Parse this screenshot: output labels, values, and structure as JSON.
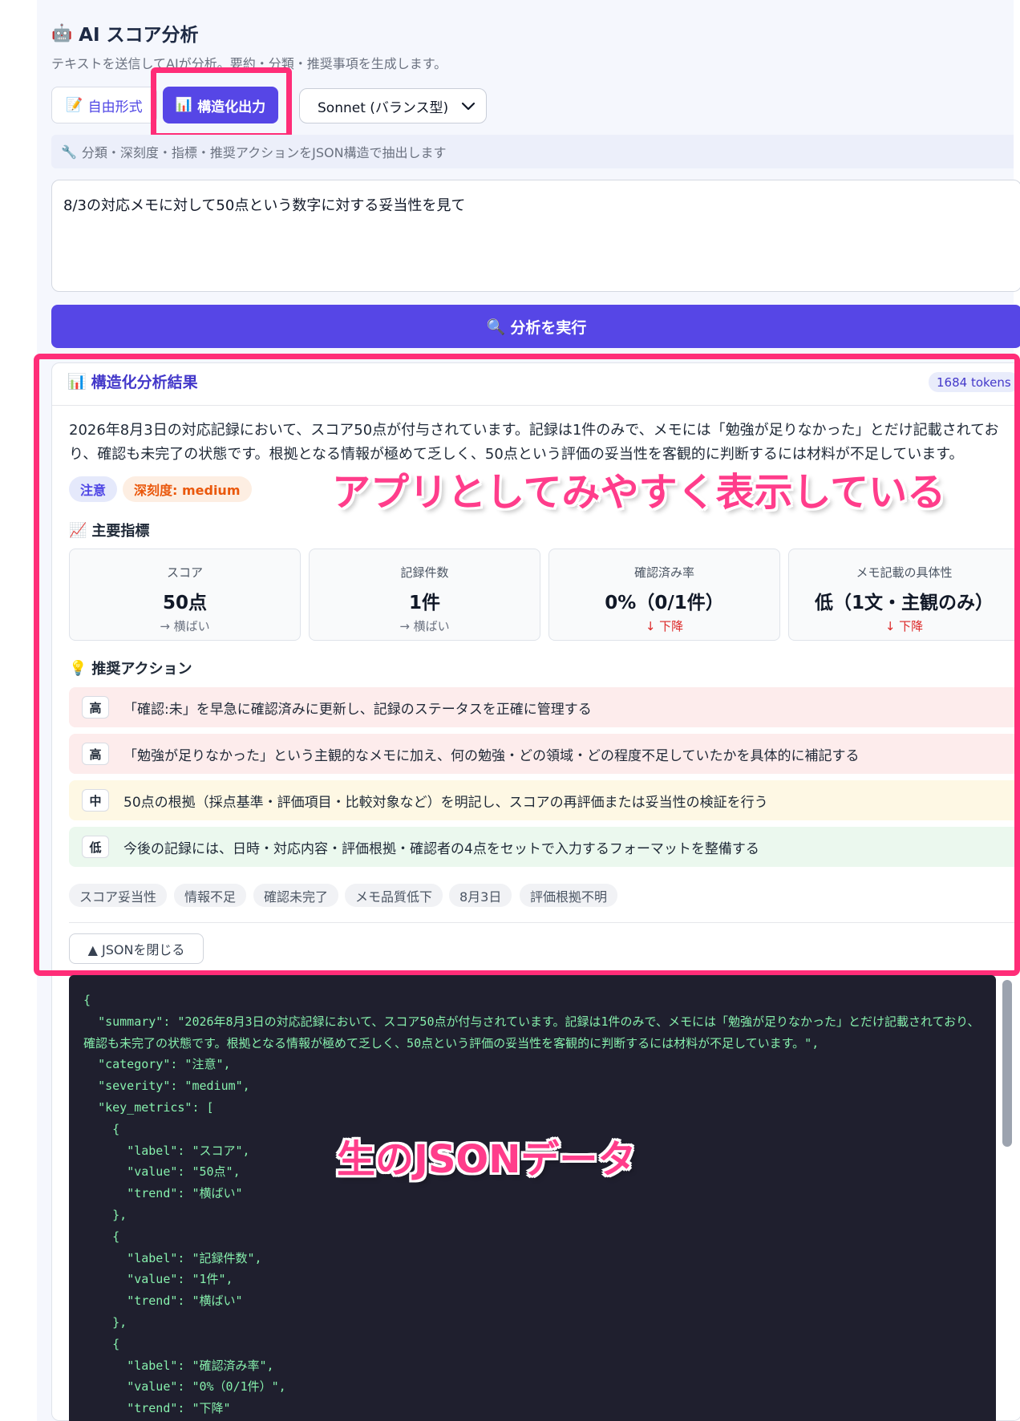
{
  "header": {
    "title_icon": "🤖",
    "title": "AI スコア分析",
    "subtitle": "テキストを送信してAIが分析。要約・分類・推奨事項を生成します。"
  },
  "tabs": [
    {
      "icon": "📝",
      "label": "自由形式",
      "active": false
    },
    {
      "icon": "📊",
      "label": "構造化出力",
      "active": true
    }
  ],
  "model_select": {
    "value": "Sonnet (バランス型)"
  },
  "hint": {
    "icon": "🔧",
    "text": "分類・深刻度・指標・推奨アクションをJSON構造で抽出します"
  },
  "input": {
    "value": "8/3の対応メモに対して50点という数字に対する妥当性を見て"
  },
  "run_button": {
    "icon": "🔍",
    "label": "分析を実行"
  },
  "result": {
    "header_icon": "📊",
    "header": "構造化分析結果",
    "tokens": "1684 tokens",
    "summary": "2026年8月3日の対応記録において、スコア50点が付与されています。記録は1件のみで、メモには「勉強が足りなかった」とだけ記載されており、確認も未完了の状態です。根拠となる情報が極めて乏しく、50点という評価の妥当性を客観的に判断するには材料が不足しています。",
    "category": "注意",
    "severity_label": "深刻度: medium",
    "metrics_title_icon": "📈",
    "metrics_title": "主要指標",
    "metrics": [
      {
        "label": "スコア",
        "value": "50点",
        "trend": "→ 横ばい",
        "trend_type": "flat"
      },
      {
        "label": "記録件数",
        "value": "1件",
        "trend": "→ 横ばい",
        "trend_type": "flat"
      },
      {
        "label": "確認済み率",
        "value": "0%（0/1件）",
        "trend": "↓ 下降",
        "trend_type": "down"
      },
      {
        "label": "メモ記載の具体性",
        "value": "低（1文・主観のみ）",
        "trend": "↓ 下降",
        "trend_type": "down"
      }
    ],
    "actions_title_icon": "💡",
    "actions_title": "推奨アクション",
    "actions": [
      {
        "priority": "高",
        "text": "「確認:未」を早急に確認済みに更新し、記録のステータスを正確に管理する"
      },
      {
        "priority": "高",
        "text": "「勉強が足りなかった」という主観的なメモに加え、何の勉強・どの領域・どの程度不足していたかを具体的に補記する"
      },
      {
        "priority": "中",
        "text": "50点の根拠（採点基準・評価項目・比較対象など）を明記し、スコアの再評価または妥当性の検証を行う"
      },
      {
        "priority": "低",
        "text": "今後の記録には、日時・対応内容・評価根拠・確認者の4点をセットで入力するフォーマットを整備する"
      }
    ],
    "tags": [
      "スコア妥当性",
      "情報不足",
      "確認未完了",
      "メモ品質低下",
      "8月3日",
      "評価根拠不明"
    ],
    "json_toggle": "▲ JSONを閉じる",
    "raw_json": "{\n  \"summary\": \"2026年8月3日の対応記録において、スコア50点が付与されています。記録は1件のみで、メモには「勉強が足りなかった」とだけ記載されており、確認も未完了の状態です。根拠となる情報が極めて乏しく、50点という評価の妥当性を客観的に判断するには材料が不足しています。\",\n  \"category\": \"注意\",\n  \"severity\": \"medium\",\n  \"key_metrics\": [\n    {\n      \"label\": \"スコア\",\n      \"value\": \"50点\",\n      \"trend\": \"横ばい\"\n    },\n    {\n      \"label\": \"記録件数\",\n      \"value\": \"1件\",\n      \"trend\": \"横ばい\"\n    },\n    {\n      \"label\": \"確認済み率\",\n      \"value\": \"0%（0/1件）\",\n      \"trend\": \"下降\""
  },
  "annotations": {
    "app_display": "アプリとしてみやすく表示している",
    "raw_json": "生のJSONデータ"
  },
  "colors": {
    "accent": "#5646e6",
    "highlight": "#ff2d78",
    "annotation_text": "#ff3d8b",
    "json_text": "#86efac",
    "json_bg": "#1f1f2e"
  }
}
